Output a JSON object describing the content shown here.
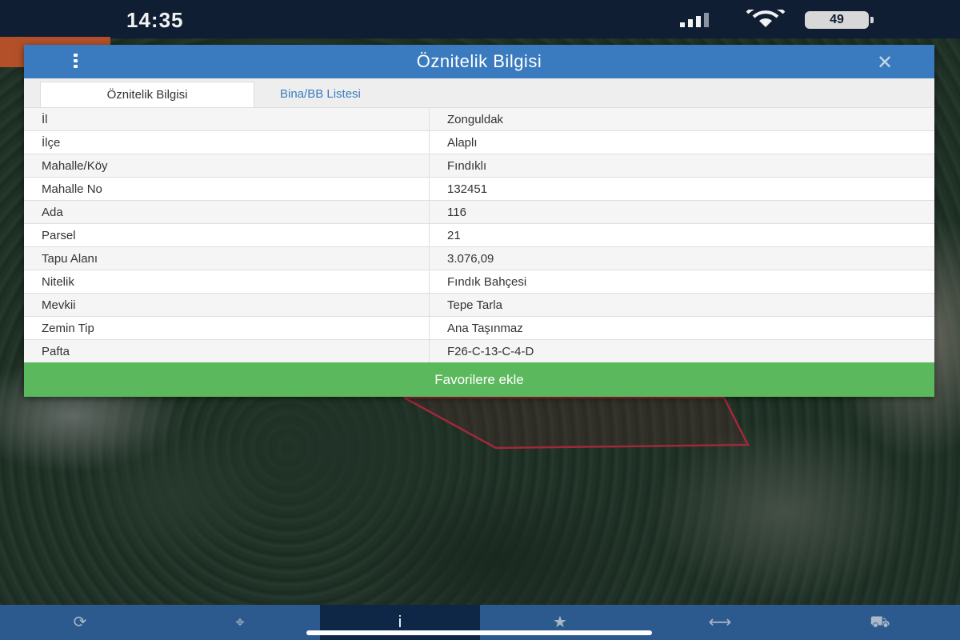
{
  "status_bar": {
    "time": "14:35",
    "battery": "49",
    "icons": [
      "signal-icon",
      "wifi-icon",
      "battery-icon"
    ]
  },
  "dialog": {
    "title": "Öznitelik Bilgisi",
    "icons": [
      "menu-icon",
      "close-icon"
    ],
    "tabs": [
      {
        "label": "Öznitelik Bilgisi",
        "active": true
      },
      {
        "label": "Bina/BB Listesi",
        "active": false
      }
    ],
    "rows": [
      {
        "key": "İl",
        "value": "Zonguldak"
      },
      {
        "key": "İlçe",
        "value": "Alaplı"
      },
      {
        "key": "Mahalle/Köy",
        "value": "Fındıklı"
      },
      {
        "key": "Mahalle No",
        "value": "132451"
      },
      {
        "key": "Ada",
        "value": "116"
      },
      {
        "key": "Parsel",
        "value": "21"
      },
      {
        "key": "Tapu Alanı",
        "value": "3.076,09"
      },
      {
        "key": "Nitelik",
        "value": "Fındık Bahçesi"
      },
      {
        "key": "Mevkii",
        "value": "Tepe Tarla"
      },
      {
        "key": "Zemin Tip",
        "value": "Ana Taşınmaz"
      },
      {
        "key": "Pafta",
        "value": "F26-C-13-C-4-D"
      }
    ],
    "favorite_button": "Favorilere ekle"
  },
  "bottom_nav": {
    "items": [
      {
        "icon": "refresh-icon",
        "glyph": "⟳",
        "active": false
      },
      {
        "icon": "crosshair-icon",
        "glyph": "⌖",
        "active": false
      },
      {
        "icon": "info-icon",
        "glyph": "i",
        "active": true
      },
      {
        "icon": "star-icon",
        "glyph": "★",
        "active": false
      },
      {
        "icon": "measure-icon",
        "glyph": "⟷",
        "active": false
      },
      {
        "icon": "car-icon",
        "glyph": "⛟",
        "active": false
      }
    ]
  },
  "colors": {
    "header_blue": "#3a7bbf",
    "button_green": "#5cb85c",
    "nav_blue": "#2c5a8e",
    "nav_active": "#0f2747",
    "status_bar": "#0f1e33",
    "parcel_outline": "#a0283a"
  }
}
